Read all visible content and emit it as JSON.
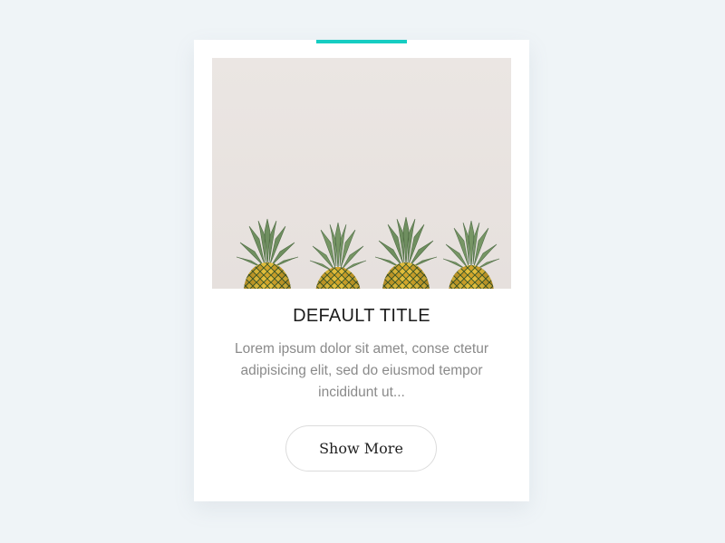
{
  "card": {
    "title": "DEFAULT TITLE",
    "description": "Lorem ipsum dolor sit amet, conse ctetur adipisicing elit, sed do eiusmod tempor incididunt ut...",
    "button_label": "Show More",
    "accent_color": "#16cdc2"
  },
  "image": {
    "subject": "four pineapples in a row against a pale wall"
  }
}
